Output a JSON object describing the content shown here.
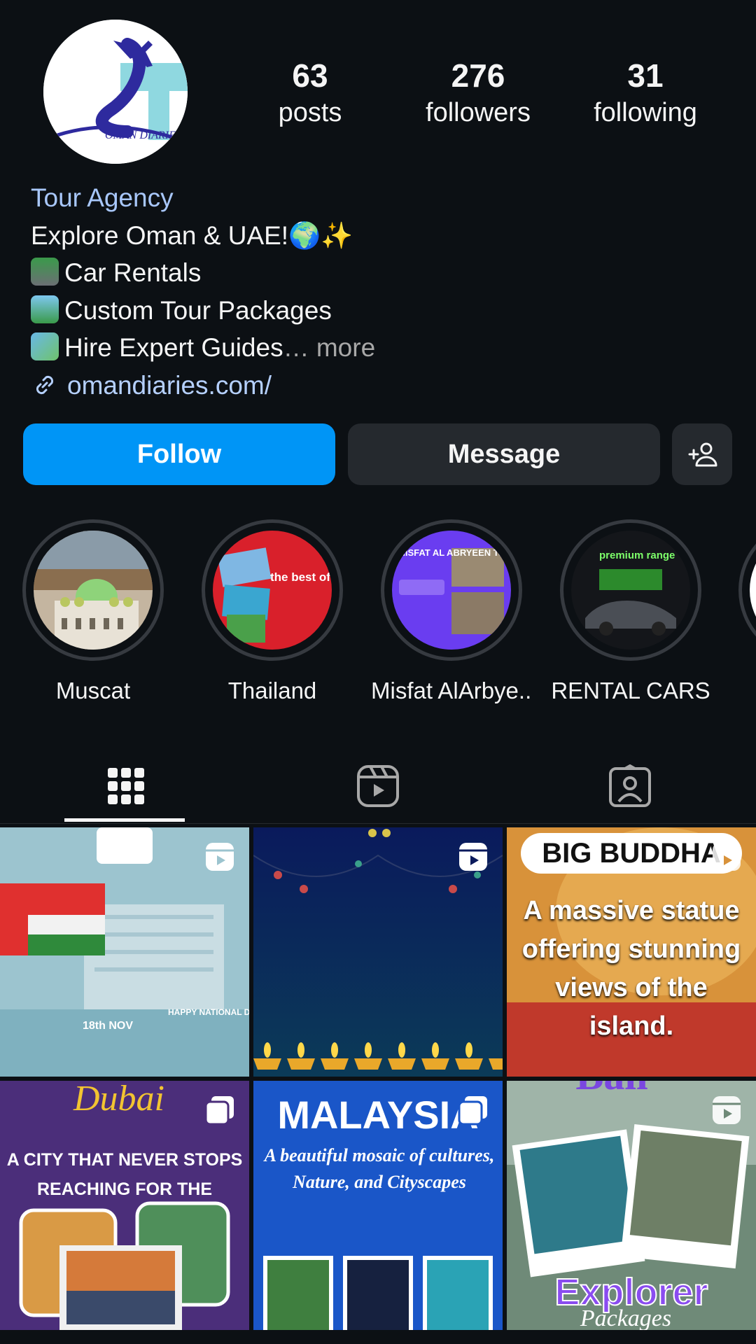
{
  "profile": {
    "stats": [
      {
        "count": "63",
        "label": "posts"
      },
      {
        "count": "276",
        "label": "followers"
      },
      {
        "count": "31",
        "label": "following"
      }
    ],
    "avatar_logo_text": "OMAN DIARIES",
    "category": "Tour Agency",
    "bio_lines": [
      "Explore Oman & UAE!🌍✨",
      "Car Rentals",
      "Custom Tour Packages",
      "Hire Expert Guides"
    ],
    "truncation": "…",
    "more_label": "more",
    "link": "omandiaries.com/"
  },
  "actions": {
    "follow": "Follow",
    "message": "Message"
  },
  "highlights": [
    {
      "name": "Muscat"
    },
    {
      "name": "Thailand",
      "text": "the best of Thailand"
    },
    {
      "name": "Misfat AlArbye...",
      "text": "MISFAT AL ABRYEEN Tour"
    },
    {
      "name": "RENTAL CARS",
      "text": "premium range"
    }
  ],
  "posts": [
    {
      "kind": "reel",
      "text1": "18th NOV",
      "text2": "HAPPY NATIONAL DAY"
    },
    {
      "kind": "reel"
    },
    {
      "kind": "reel",
      "title": "BIG BUDDHA",
      "text": "A massive statue offering stunning views of the island."
    },
    {
      "kind": "carousel",
      "title": "Dubai",
      "text": "A CITY THAT NEVER STOPS REACHING FOR THE STARS."
    },
    {
      "kind": "carousel",
      "title": "MALAYSIA",
      "text": "A beautiful mosaic of cultures, Nature, and Cityscapes"
    },
    {
      "kind": "reel",
      "title": "Explorer",
      "text": "Packages"
    }
  ],
  "colors": {
    "background": "#0c1014",
    "follow_button": "#0095f6",
    "secondary_button": "#25292e",
    "link": "#b5d0ff"
  }
}
